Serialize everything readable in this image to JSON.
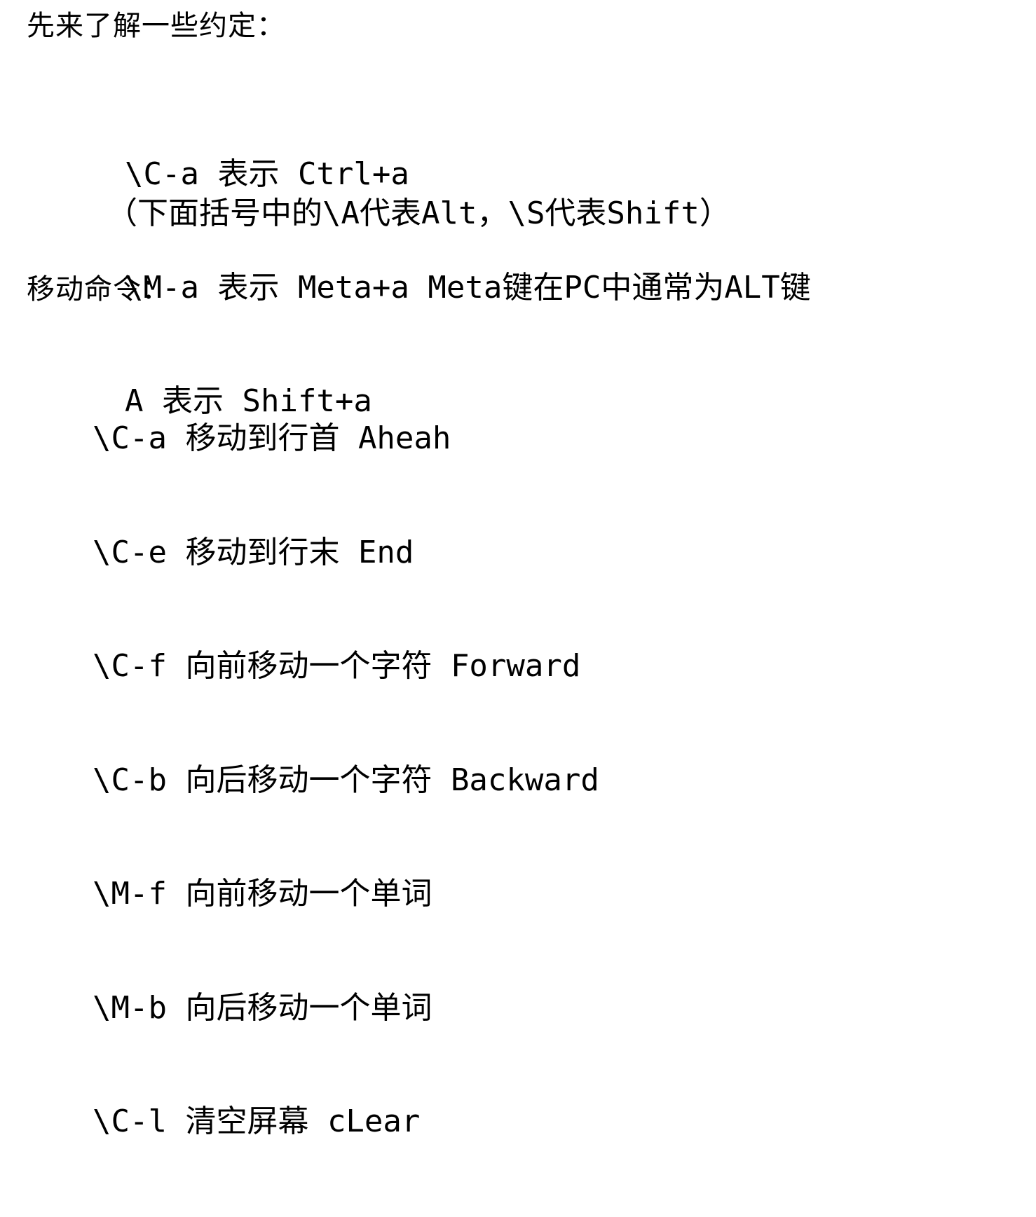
{
  "conventions": {
    "heading": "先来了解一些约定：",
    "items": [
      "\\C-a 表示 Ctrl+a",
      "\\M-a 表示 Meta+a Meta键在PC中通常为ALT键",
      "A 表示 Shift+a"
    ],
    "note": "（下面括号中的\\A代表Alt，\\S代表Shift）"
  },
  "movement": {
    "heading": "移动命令：",
    "items": [
      "\\C-a 移动到行首 Aheah",
      "\\C-e 移动到行末 End",
      "\\C-f 向前移动一个字符 Forward",
      "\\C-b 向后移动一个字符 Backward",
      "\\M-f 向前移动一个单词",
      "\\M-b 向后移动一个单词",
      "\\C-l 清空屏幕 cLear"
    ]
  }
}
